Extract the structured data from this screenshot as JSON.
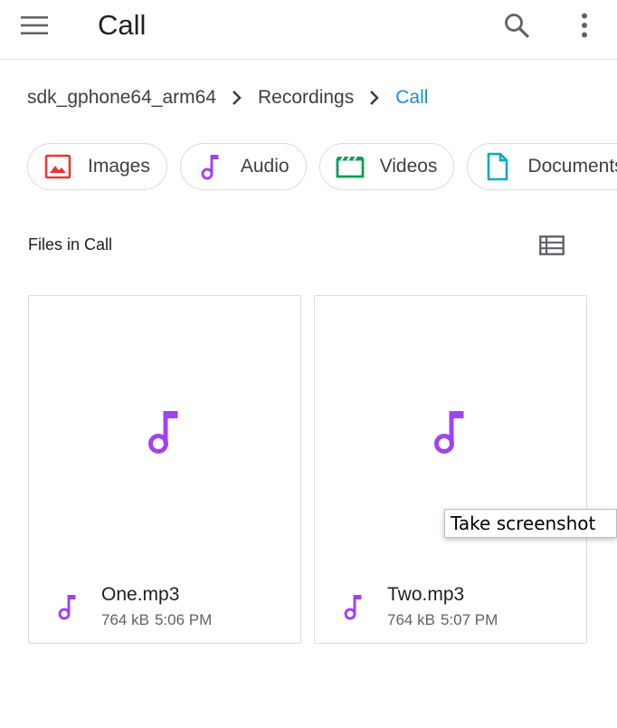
{
  "appbar": {
    "title": "Call",
    "icons": {
      "menu": "menu-icon",
      "search": "search-icon",
      "more": "more-vert-icon"
    }
  },
  "breadcrumb": {
    "items": [
      "sdk_gphone64_arm64",
      "Recordings",
      "Call"
    ],
    "separator_icon": "chevron-right-icon"
  },
  "chips": [
    {
      "label": "Images",
      "icon": "image-icon",
      "color": "#e53935"
    },
    {
      "label": "Audio",
      "icon": "music-note-icon",
      "color": "#9c27b0"
    },
    {
      "label": "Videos",
      "icon": "movie-icon",
      "color": "#0f9d58"
    },
    {
      "label": "Documents",
      "icon": "document-icon",
      "color": "#00acc1"
    }
  ],
  "section": {
    "title": "Files in Call",
    "view_toggle_icon": "list-view-icon"
  },
  "files": [
    {
      "name": "One.mp3",
      "size": "764 kB",
      "time": "5:06 PM",
      "icon": "music-note-icon"
    },
    {
      "name": "Two.mp3",
      "size": "764 kB",
      "time": "5:07 PM",
      "icon": "music-note-icon"
    }
  ],
  "tooltip": {
    "text": "Take screenshot"
  },
  "colors": {
    "accent": "#1a8ed6",
    "audio": "#a142f4",
    "divider": "#e0e0e0"
  }
}
